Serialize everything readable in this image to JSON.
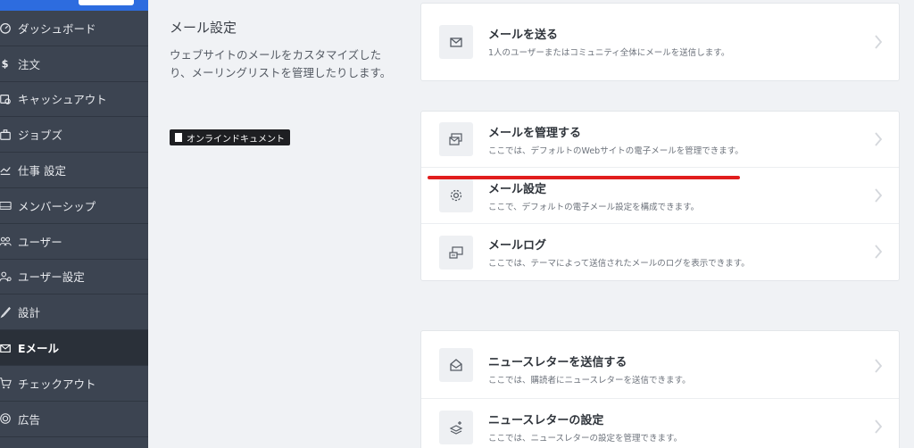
{
  "sidebar": {
    "items": [
      {
        "label": "ダッシュボード",
        "icon": "dashboard-icon"
      },
      {
        "label": "注文",
        "icon": "dollar-icon"
      },
      {
        "label": "キャッシュアウト",
        "icon": "cashout-icon"
      },
      {
        "label": "ジョブズ",
        "icon": "briefcase-icon"
      },
      {
        "label": "仕事 設定",
        "icon": "job-settings-icon"
      },
      {
        "label": "メンバーシップ",
        "icon": "membership-icon"
      },
      {
        "label": "ユーザー",
        "icon": "users-icon"
      },
      {
        "label": "ユーザー設定",
        "icon": "user-settings-icon"
      },
      {
        "label": "設計",
        "icon": "brush-icon"
      },
      {
        "label": "Eメール",
        "icon": "envelope-icon",
        "active": true
      },
      {
        "label": "チェックアウト",
        "icon": "cart-icon"
      },
      {
        "label": "広告",
        "icon": "ad-icon"
      }
    ]
  },
  "main": {
    "title": "メール設定",
    "description": "ウェブサイトのメールをカスタマイズしたり、メーリングリストを管理したりします。",
    "doc_button": "オンラインドキュメント",
    "cards": [
      {
        "rows": [
          {
            "title": "メールを送る",
            "sub": "1人のユーザーまたはコミュニティ全体にメールを送信します。",
            "icon": "envelope-icon"
          }
        ]
      },
      {
        "rows": [
          {
            "title": "メールを管理する",
            "sub": "ここでは、デフォルトのWebサイトの電子メールを管理できます。",
            "icon": "manage-mail-icon"
          },
          {
            "title": "メール設定",
            "sub": "ここで、デフォルトの電子メール設定を構成できます。",
            "icon": "gear-icon"
          },
          {
            "title": "メールログ",
            "sub": "ここでは、テーマによって送信されたメールのログを表示できます。",
            "icon": "mail-log-icon"
          }
        ]
      },
      {
        "rows": [
          {
            "title": "ニュースレターを送信する",
            "sub": "ここでは、購読者にニュースレターを送信できます。",
            "icon": "open-envelope-icon"
          },
          {
            "title": "ニュースレターの設定",
            "sub": "ここでは、ニュースレターの設定を管理できます。",
            "icon": "newsletter-settings-icon"
          }
        ]
      }
    ]
  },
  "colors": {
    "sidebar_bg": "#3c4451",
    "sidebar_active": "#2a3039",
    "brand_blue": "#2d6cdf",
    "highlight_red": "#e11d1d"
  }
}
